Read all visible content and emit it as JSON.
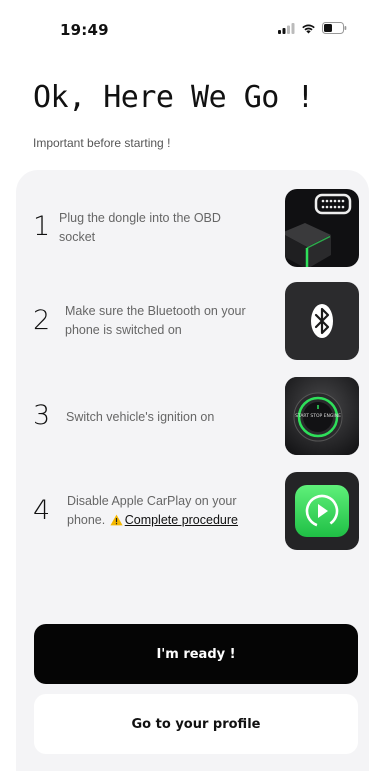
{
  "status_bar": {
    "time": "19:49",
    "icons": [
      "signal-icon",
      "wifi-icon",
      "battery-icon"
    ]
  },
  "header": {
    "title": "Ok, Here We Go !",
    "subtitle": "Important before starting !"
  },
  "steps": [
    {
      "number": "1",
      "text": "Plug the dongle into the OBD socket",
      "image": "obd-dongle-image"
    },
    {
      "number": "2",
      "text": "Make sure the Bluetooth on your phone is switched on",
      "image": "bluetooth-image"
    },
    {
      "number": "3",
      "text": "Switch vehicle's ignition on",
      "image": "ignition-button-image"
    },
    {
      "number": "4",
      "text": "Disable Apple CarPlay on your phone.",
      "link": "Complete procedure",
      "image": "carplay-image"
    }
  ],
  "ignition_label": "START STOP ENGINE",
  "buttons": {
    "primary": "I'm ready !",
    "secondary": "Go to your profile"
  },
  "colors": {
    "card_background": "#f4f4f6",
    "primary_button": "#050505",
    "accent_green": "#2ee05a",
    "warning": "#f5b800"
  }
}
